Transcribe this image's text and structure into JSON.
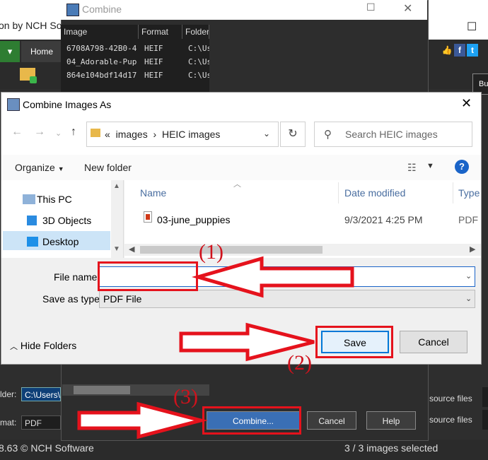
{
  "background_app": {
    "title_partial": "on by NCH Sof",
    "tab_home": "Home",
    "button_partial": "Bu",
    "footer_left": "8.63 © NCH Software",
    "footer_right": "3 / 3 images selected",
    "right_label_1": "source files",
    "right_label_2": "source files",
    "side_label_1": "lder:",
    "side_label_2": "mat:"
  },
  "combine_window": {
    "title": "Combine",
    "columns": [
      "Image",
      "Format",
      "Folder"
    ],
    "rows": [
      {
        "image": "6708A798-42B0-4...",
        "format": "HEIF",
        "folder": "C:\\Us"
      },
      {
        "image": "04_Adorable-Pup...",
        "format": "HEIF",
        "folder": "C:\\Us"
      },
      {
        "image": "864e104bdf14d17...",
        "format": "HEIF",
        "folder": "C:\\Us"
      }
    ],
    "folder_value": "C:\\Users\\",
    "format_value": "PDF",
    "combine_label": "Combine...",
    "cancel_label": "Cancel",
    "help_label": "Help"
  },
  "dialog": {
    "title": "Combine Images As",
    "address": {
      "prefix": "«",
      "segments": [
        "images",
        "HEIC images"
      ],
      "separator": "›"
    },
    "search_placeholder": "Search HEIC images",
    "toolbar": {
      "organize": "Organize",
      "new_folder": "New folder"
    },
    "nav_items": [
      {
        "label": "This PC",
        "icon": "computer-icon"
      },
      {
        "label": "3D Objects",
        "icon": "cube-icon"
      },
      {
        "label": "Desktop",
        "icon": "desktop-icon",
        "selected": true
      }
    ],
    "columns": [
      "Name",
      "Date modified",
      "Type"
    ],
    "files": [
      {
        "name": "03-june_puppies",
        "date": "9/3/2021 4:25 PM",
        "type": "PDF"
      }
    ],
    "file_name_label": "File name:",
    "file_name_value": "",
    "save_type_label": "Save as type:",
    "save_type_value": "PDF File",
    "hide_folders": "Hide Folders",
    "save_label": "Save",
    "cancel_label": "Cancel"
  },
  "annotations": {
    "step1": "(1)",
    "step2": "(2)",
    "step3": "(3)",
    "color": "#e5121c"
  }
}
